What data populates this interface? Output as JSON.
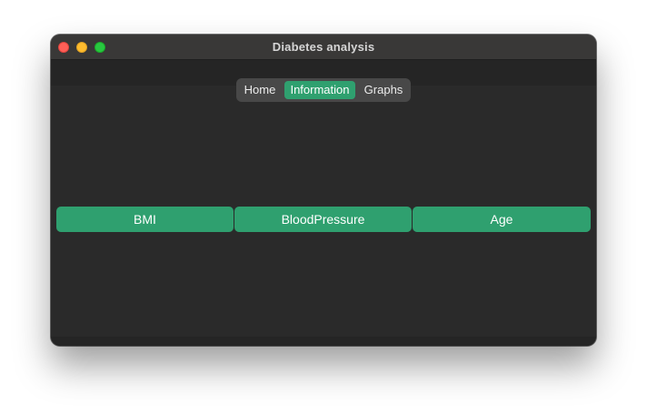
{
  "window": {
    "title": "Diabetes analysis"
  },
  "tabs": [
    {
      "label": "Home",
      "selected": false
    },
    {
      "label": "Information",
      "selected": true
    },
    {
      "label": "Graphs",
      "selected": false
    }
  ],
  "buttons": [
    {
      "label": "BMI"
    },
    {
      "label": "BloodPressure"
    },
    {
      "label": "Age"
    }
  ],
  "colors": {
    "accent": "#2fa06f",
    "window_bg": "#2a2a2a",
    "titlebar_bg": "#393837",
    "segmented_bg": "#484848"
  }
}
